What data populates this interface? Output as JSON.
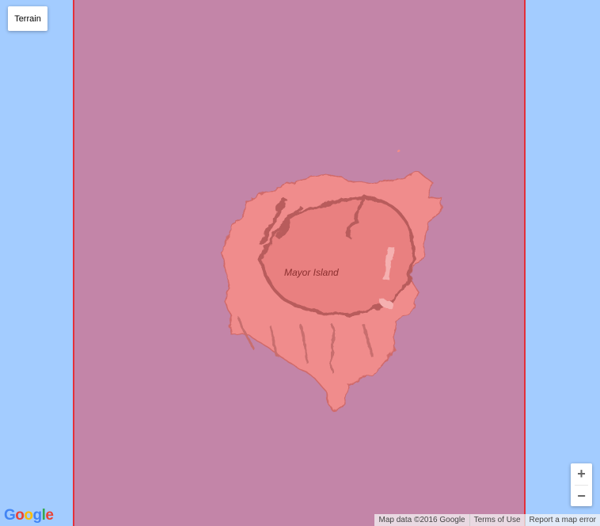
{
  "map": {
    "controls": {
      "map_type_label": "Terrain",
      "zoom_in": "+",
      "zoom_out": "−"
    },
    "place_label": "Mayor Island",
    "footer": {
      "attribution": "Map data ©2016 Google",
      "terms": "Terms of Use",
      "report": "Report a map error"
    },
    "logo": {
      "g1": "G",
      "o1": "o",
      "o2": "o",
      "g2": "g",
      "l": "l",
      "e": "e"
    },
    "colors": {
      "water": "#a3ccff",
      "overlay_fill": "#c385a8",
      "overlay_stroke": "#e3303a",
      "island": "#f08c8c"
    }
  }
}
